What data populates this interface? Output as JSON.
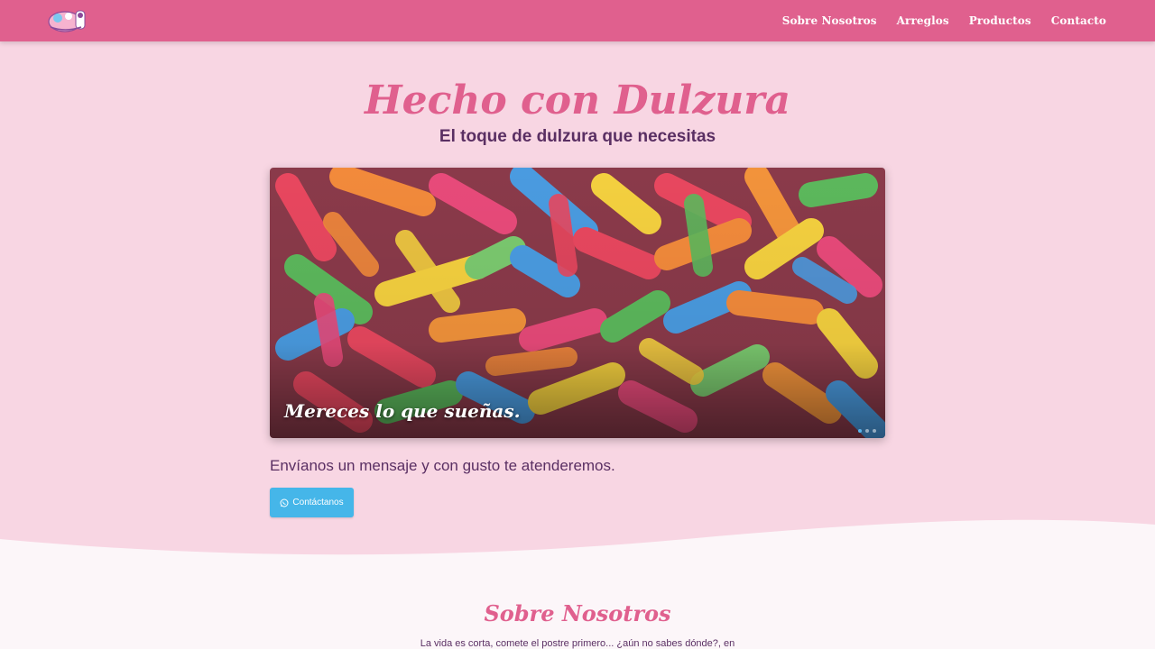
{
  "nav": {
    "items": [
      {
        "label": "Sobre Nosotros"
      },
      {
        "label": "Arreglos"
      },
      {
        "label": "Productos"
      },
      {
        "label": "Contacto"
      }
    ]
  },
  "hero": {
    "title": "Hecho con Dulzura",
    "subtitle": "El toque de dulzura que necesitas"
  },
  "carousel": {
    "caption": "Mereces lo que sueñas.",
    "slide_count": 3,
    "active_index": 0
  },
  "cta": {
    "text": "Envíanos un mensaje y con gusto te atenderemos.",
    "button_label": "Contáctanos",
    "button_icon": "whatsapp-icon"
  },
  "about": {
    "title": "Sobre Nosotros",
    "text": "La vida es corta, cometе el postre primero... ¿aún no sabes dónde?, en"
  },
  "colors": {
    "brand_pink": "#e0608e",
    "background": "#f8d6e3",
    "text_purple": "#5a2f63",
    "button_blue": "#45b6e9"
  }
}
